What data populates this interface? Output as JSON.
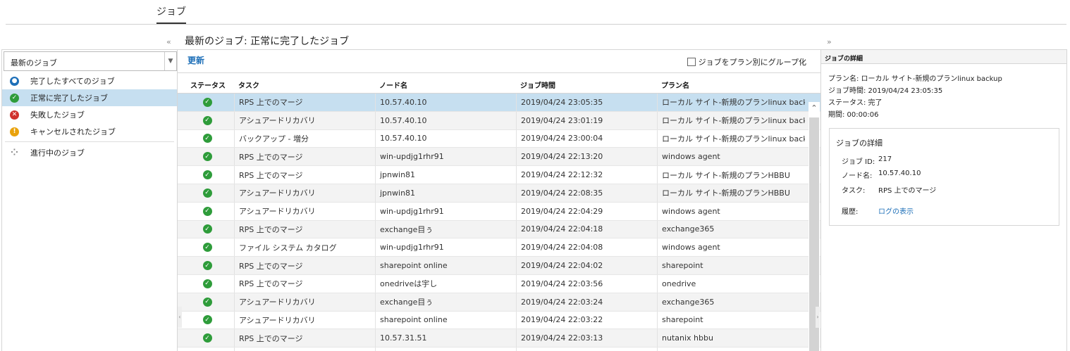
{
  "top_tab": "ジョブ",
  "page_title": "最新のジョブ: 正常に完了したジョブ",
  "filter": {
    "dropdown_value": "最新のジョブ",
    "items": [
      {
        "label": "完了したすべてのジョブ",
        "icon": "all-jobs-icon",
        "color": "#1d6fb8",
        "glyph": "●"
      },
      {
        "label": "正常に完了したジョブ",
        "icon": "success-icon",
        "color": "#2e9c3a",
        "glyph": "✓"
      },
      {
        "label": "失敗したジョブ",
        "icon": "failed-icon",
        "color": "#d0312d",
        "glyph": "✕"
      },
      {
        "label": "キャンセルされたジョブ",
        "icon": "canceled-icon",
        "color": "#e9a20c",
        "glyph": "!"
      }
    ],
    "in_progress_label": "進行中のジョブ"
  },
  "toolbar": {
    "refresh_label": "更新",
    "group_by_plan_label": "ジョブをプラン別にグループ化"
  },
  "table": {
    "headers": {
      "status": "ステータス",
      "task": "タスク",
      "node": "ノード名",
      "time": "ジョブ時間",
      "plan": "プラン名"
    },
    "rows": [
      {
        "task": "RPS 上でのマージ",
        "node": "10.57.40.10",
        "time": "2019/04/24 23:05:35",
        "plan": "ローカル サイト-新規のプランlinux backup"
      },
      {
        "task": "アシュアードリカバリ",
        "node": "10.57.40.10",
        "time": "2019/04/24 23:01:19",
        "plan": "ローカル サイト-新規のプランlinux backup"
      },
      {
        "task": "バックアップ - 増分",
        "node": "10.57.40.10",
        "time": "2019/04/24 23:00:04",
        "plan": "ローカル サイト-新規のプランlinux backup"
      },
      {
        "task": "RPS 上でのマージ",
        "node": "win-updjg1rhr91",
        "time": "2019/04/24 22:13:20",
        "plan": "windows agent"
      },
      {
        "task": "RPS 上でのマージ",
        "node": "jpnwin81",
        "time": "2019/04/24 22:12:32",
        "plan": "ローカル サイト-新規のプランHBBU"
      },
      {
        "task": "アシュアードリカバリ",
        "node": "jpnwin81",
        "time": "2019/04/24 22:08:35",
        "plan": "ローカル サイト-新規のプランHBBU"
      },
      {
        "task": "アシュアードリカバリ",
        "node": "win-updjg1rhr91",
        "time": "2019/04/24 22:04:29",
        "plan": "windows agent"
      },
      {
        "task": "RPS 上でのマージ",
        "node": "exchange目ぅ",
        "time": "2019/04/24 22:04:18",
        "plan": "exchange365"
      },
      {
        "task": "ファイル システム カタログ",
        "node": "win-updjg1rhr91",
        "time": "2019/04/24 22:04:08",
        "plan": "windows agent"
      },
      {
        "task": "RPS 上でのマージ",
        "node": "sharepoint online",
        "time": "2019/04/24 22:04:02",
        "plan": "sharepoint"
      },
      {
        "task": "RPS 上でのマージ",
        "node": "onedriveは宇し",
        "time": "2019/04/24 22:03:56",
        "plan": "onedrive"
      },
      {
        "task": "アシュアードリカバリ",
        "node": "exchange目ぅ",
        "time": "2019/04/24 22:03:24",
        "plan": "exchange365"
      },
      {
        "task": "アシュアードリカバリ",
        "node": "sharepoint online",
        "time": "2019/04/24 22:03:22",
        "plan": "sharepoint"
      },
      {
        "task": "RPS 上でのマージ",
        "node": "10.57.31.51",
        "time": "2019/04/24 22:03:13",
        "plan": "nutanix hbbu"
      },
      {
        "task": "",
        "node": "",
        "time": "",
        "plan": ""
      }
    ]
  },
  "details": {
    "header": "ジョブの詳細",
    "lines": [
      "プラン名: ローカル サイト-新規のプランlinux backup",
      "ジョブ時間: 2019/04/24 23:05:35",
      "ステータス: 完了",
      "期間: 00:00:06"
    ],
    "box_title": "ジョブの詳細",
    "job_id_label": "ジョブ ID:",
    "job_id": "217",
    "node_label": "ノード名:",
    "node": "10.57.40.10",
    "task_label": "タスク:",
    "task": "RPS 上でのマージ",
    "history_label": "履歴:",
    "history_link": "ログの表示"
  }
}
